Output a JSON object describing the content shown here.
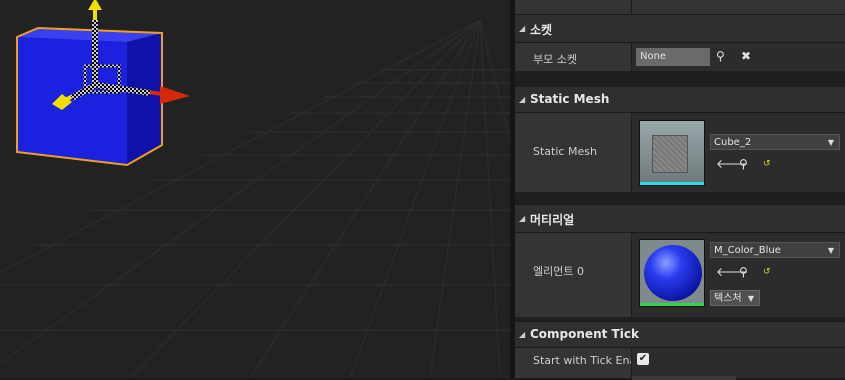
{
  "socket": {
    "category": "소켓",
    "parent_socket_label": "부모 소켓",
    "parent_socket_value": "None"
  },
  "static_mesh": {
    "category": "Static Mesh",
    "label": "Static Mesh",
    "value": "Cube_2"
  },
  "materials": {
    "category": "머티리얼",
    "element_label": "엘리먼트 0",
    "value": "M_Color_Blue",
    "texture_button": "텍스처"
  },
  "component_tick": {
    "category": "Component Tick",
    "start_label": "Start with Tick Enabled",
    "start_checked": true
  },
  "icons": {
    "browse": "magnifier-icon",
    "clear": "x-icon",
    "use_selected": "arrow-left-icon",
    "reset": "reset-arrow-icon",
    "expand": "triangle-down-icon"
  },
  "colors": {
    "accent_cyan": "#22e0e8",
    "accent_green": "#2bd94a",
    "selection_orange": "#f0a020",
    "gizmo_x": "#d42a0a",
    "gizmo_y": "#20c020",
    "gizmo_z": "#f0e000",
    "cube": "#1a22e0"
  }
}
